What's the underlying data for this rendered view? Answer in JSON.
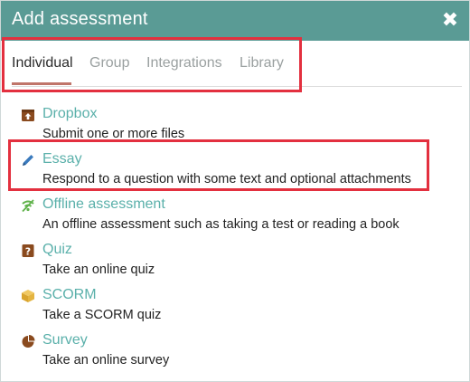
{
  "dialog": {
    "title": "Add assessment",
    "close_icon": "close-icon"
  },
  "tabs": [
    {
      "label": "Individual",
      "active": true
    },
    {
      "label": "Group",
      "active": false
    },
    {
      "label": "Integrations",
      "active": false
    },
    {
      "label": "Library",
      "active": false
    }
  ],
  "items": [
    {
      "label": "Dropbox",
      "description": "Submit one or more files",
      "icon": "dropbox-upload-icon"
    },
    {
      "label": "Essay",
      "description": "Respond to a question with some text and optional attachments",
      "icon": "pencil-icon"
    },
    {
      "label": "Offline assessment",
      "description": "An offline assessment such as taking a test or reading a book",
      "icon": "offline-icon"
    },
    {
      "label": "Quiz",
      "description": "Take an online quiz",
      "icon": "quiz-icon"
    },
    {
      "label": "SCORM",
      "description": "Take a SCORM quiz",
      "icon": "scorm-box-icon"
    },
    {
      "label": "Survey",
      "description": "Take an online survey",
      "icon": "pie-chart-icon"
    }
  ],
  "colors": {
    "header": "#5a9b95",
    "link": "#5ab0aa",
    "active_tab_underline": "#c0756a",
    "highlight": "#e3303f",
    "icon_brown": "#8a4a1e",
    "icon_blue": "#3a7abd",
    "icon_green": "#5fb24a",
    "icon_gold": "#e4b440"
  }
}
